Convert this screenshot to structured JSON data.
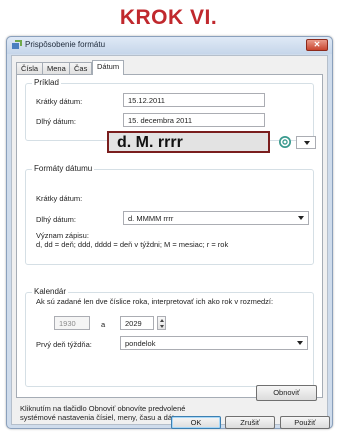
{
  "step_title": "KROK VI.",
  "window": {
    "title": "Prispôsobenie formátu",
    "close_label": "✕"
  },
  "tabs": [
    {
      "label": "Čísla",
      "active": false
    },
    {
      "label": "Mena",
      "active": false
    },
    {
      "label": "Čas",
      "active": false
    },
    {
      "label": "Dátum",
      "active": true
    }
  ],
  "example": {
    "group_label": "Príklad",
    "short_label": "Krátky dátum:",
    "short_value": "15.12.2011",
    "long_label": "Dlhý dátum:",
    "long_value": "15. decembra 2011"
  },
  "formats": {
    "group_label": "Formáty dátumu",
    "short_label": "Krátky dátum:",
    "short_value": "d. M. rrrr",
    "long_label": "Dlhý dátum:",
    "long_value": "d. MMMM rrrr",
    "meaning_title": "Význam zápisu:",
    "meaning_text": "d, dd = deň;  ddd, dddd = deň v týždni; M = mesiac; r = rok"
  },
  "calendar": {
    "group_label": "Kalendár",
    "description": "Ak sú zadané len dve číslice roka, interpretovať ich ako rok v rozmedzí:",
    "year_from": "1930",
    "year_sep": "a",
    "year_to": "2029",
    "first_day_label": "Prvý deň týždňa:",
    "first_day_value": "pondelok"
  },
  "footer": {
    "restore_text_line1": "Kliknutím na tlačidlo Obnoviť obnovíte predvolené",
    "restore_text_line2": "systémové nastavenia čísiel, meny, času a dátumu.",
    "restore_button": "Obnoviť",
    "ok_button": "OK",
    "cancel_button": "Zrušiť",
    "apply_button": "Použiť"
  },
  "colors": {
    "step_title": "#c0282d",
    "highlight_border": "#7a1e1e"
  }
}
